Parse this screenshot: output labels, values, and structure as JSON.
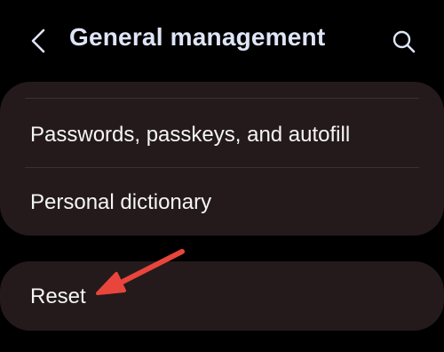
{
  "header": {
    "back_icon": "chevron-left-icon",
    "title": "General management",
    "search_icon": "search-icon"
  },
  "settings": {
    "items": [
      {
        "label": "Passwords, passkeys, and autofill"
      },
      {
        "label": "Personal dictionary"
      }
    ],
    "reset_label": "Reset"
  },
  "annotation": {
    "arrow_color": "#e8453c",
    "arrow_icon": "red-arrow-pointer-icon"
  },
  "colors": {
    "background": "#000000",
    "card": "#241a1c",
    "title_text": "#dfe5f7",
    "item_text": "#f5f5f5"
  }
}
